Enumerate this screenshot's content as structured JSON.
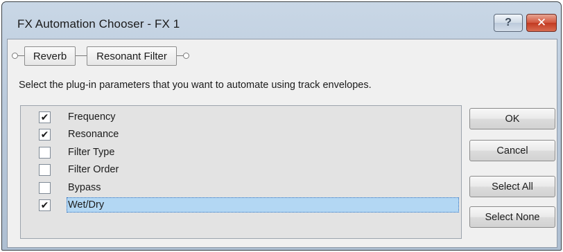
{
  "window": {
    "title": "FX Automation Chooser - FX 1"
  },
  "titlebar": {
    "help_label": "?",
    "close_label": "✕"
  },
  "chain": {
    "items": [
      {
        "label": "Reverb"
      },
      {
        "label": "Resonant Filter"
      }
    ]
  },
  "instructions": "Select the plug-in parameters that you want to automate using track envelopes.",
  "parameters": [
    {
      "label": "Frequency",
      "checked": true,
      "selected": false
    },
    {
      "label": "Resonance",
      "checked": true,
      "selected": false
    },
    {
      "label": "Filter Type",
      "checked": false,
      "selected": false
    },
    {
      "label": "Filter Order",
      "checked": false,
      "selected": false
    },
    {
      "label": "Bypass",
      "checked": false,
      "selected": false
    },
    {
      "label": "Wet/Dry",
      "checked": true,
      "selected": true
    }
  ],
  "buttons": {
    "ok": "OK",
    "cancel": "Cancel",
    "select_all": "Select All",
    "select_none": "Select None"
  },
  "check_glyph": "✔"
}
